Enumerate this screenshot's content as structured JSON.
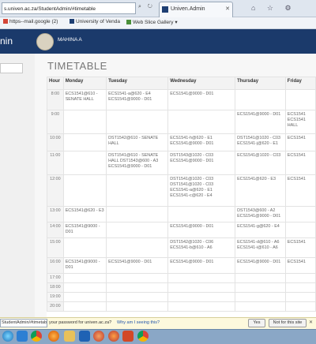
{
  "browser": {
    "url": "s.univen.ac.za/StudentAdmin/#timetable",
    "nav_glyphs": "⌕ ↻ ✕",
    "tab_title": "Univen.Admin",
    "tab_close": "✕",
    "tool_glyphs": "⌂ ☆ ⚙",
    "favorites": [
      "https--mail.google (2)",
      "University of Venda",
      "Web Slice Gallery ▾"
    ]
  },
  "app": {
    "brand": "nin",
    "user": "MAHINA A"
  },
  "page": {
    "title": "TIMETABLE"
  },
  "timetable": {
    "headers": [
      "Hour",
      "Monday",
      "Tuesday",
      "Wednesday",
      "Thursday",
      "Friday"
    ],
    "rows": [
      {
        "hour": "8:00",
        "cells": [
          "ECS1541@610 - SENATE HALL",
          "ECS1541-a@620 - E4 ECS1541@9000 - D01",
          "ECS1541@9000 - D01",
          "",
          ""
        ]
      },
      {
        "hour": "9:00",
        "cells": [
          "",
          "",
          "",
          "ECS1541@9000 - D01",
          "ECS1541 ECS1541 HALL"
        ]
      },
      {
        "hour": "10:00",
        "cells": [
          "",
          "DST1542@610 - SENATE HALL",
          "ECS1541-h@620 - E1 ECS1541@9000 - D01",
          "DST1541@1020 - C03 ECS1541-j@620 - E1",
          "ECS1541"
        ]
      },
      {
        "hour": "11:00",
        "cells": [
          "",
          "DST1541@610 - SENATE HALL DST1543@600 - A3 ECS1541@9000 - D01",
          "DST1543@1020 - C03 ECS1541@9000 - D01",
          "ECS1541@1020 - C03",
          "ECS1541"
        ]
      },
      {
        "hour": "12:00",
        "cells": [
          "",
          "",
          "DST1541@1020 - C03 DST1541@1020 - C03 ECS1541-a@620 - E1 ECS1541-c@620 - E4",
          "ECS1541@620 - E3",
          "ECS1541"
        ]
      },
      {
        "hour": "13:00",
        "cells": [
          "ECS1541@620 - E3",
          "",
          "",
          "DST1543@600 - A2 ECS1541@9000 - D01",
          ""
        ]
      },
      {
        "hour": "14:00",
        "cells": [
          "ECS1541@9000 - D01",
          "",
          "ECS1541@9000 - D01",
          "ECS1541-g@620 - E4",
          ""
        ]
      },
      {
        "hour": "15:00",
        "cells": [
          "",
          "",
          "DST1542@1020 - C06 ECS1541-b@610 - A6",
          "ECS1541-d@610 - A6 ECS1541-i@610 - A6",
          "ECS1541"
        ]
      },
      {
        "hour": "16:00",
        "cells": [
          "ECS1541@9000 - D01",
          "ECS1541@9000 - D01",
          "ECS1541@9000 - D01",
          "ECS1541@9000 - D01",
          "ECS1541"
        ]
      },
      {
        "hour": "17:00",
        "cells": [
          "",
          "",
          "",
          "",
          ""
        ]
      },
      {
        "hour": "18:00",
        "cells": [
          "",
          "",
          "",
          "",
          ""
        ]
      },
      {
        "hour": "19:00",
        "cells": [
          "",
          "",
          "",
          "",
          ""
        ]
      },
      {
        "hour": "20:00",
        "cells": [
          "",
          "",
          "",
          "",
          ""
        ]
      }
    ]
  },
  "password_prompt": {
    "url": "StudentAdmin/#timetable",
    "text": "your password for univen.ac.za?",
    "link": "Why am I seeing this?",
    "yes": "Yes",
    "not_for_site": "Not for this site",
    "close": "✕"
  },
  "colors": {
    "header_blue": "#1b3a6b",
    "taskbar": "#8aa7c6",
    "prompt_bg": "#fdf9dd"
  },
  "taskbar_icons": [
    "start-orb",
    "ie",
    "chrome",
    "firefox",
    "explorer",
    "outlook",
    "media",
    "firefox-2",
    "powerpoint",
    "chrome-2"
  ]
}
